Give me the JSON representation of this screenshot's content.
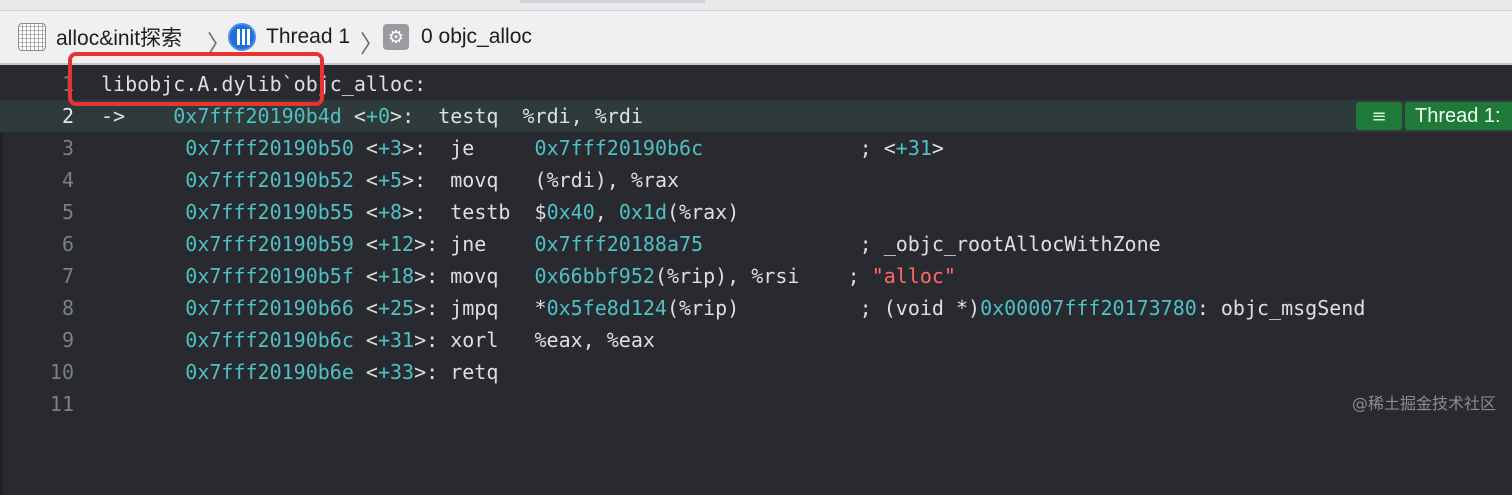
{
  "pathbar": {
    "project": "alloc&init探索",
    "thread": "Thread 1",
    "frame": "0 objc_alloc",
    "project_icon": "project-icon",
    "thread_icon": "thread-icon",
    "frame_icon": "gear-icon"
  },
  "editor": {
    "lines": [
      {
        "num": "1",
        "text": "libobjc.A.dylib`objc_alloc:"
      },
      {
        "num": "2",
        "arrow": "->",
        "addr": "0x7fff20190b4d",
        "off": "+0",
        "mnemonic": "testq",
        "ops": "%rdi, %rdi"
      },
      {
        "num": "3",
        "addr": "0x7fff20190b50",
        "off": "+3",
        "mnemonic": "je",
        "ops": "0x7fff20190b6c",
        "comment_off": "+31"
      },
      {
        "num": "4",
        "addr": "0x7fff20190b52",
        "off": "+5",
        "mnemonic": "movq",
        "ops": "(%rdi), %rax"
      },
      {
        "num": "5",
        "addr": "0x7fff20190b55",
        "off": "+8",
        "mnemonic": "testb",
        "ops_imm": "0x40",
        "ops_disp": "0x1d",
        "ops_reg": "(%rax)"
      },
      {
        "num": "6",
        "addr": "0x7fff20190b59",
        "off": "+12",
        "mnemonic": "jne",
        "ops": "0x7fff20188a75",
        "comment": "_objc_rootAllocWithZone"
      },
      {
        "num": "7",
        "addr": "0x7fff20190b5f",
        "off": "+18",
        "mnemonic": "movq",
        "ops_disp": "0x66bbf952",
        "ops_rest": "(%rip), %rsi",
        "comment_str": "\"alloc\""
      },
      {
        "num": "8",
        "addr": "0x7fff20190b66",
        "off": "+25",
        "mnemonic": "jmpq",
        "ops_disp": "0x5fe8d124",
        "ops_rest": "(%rip)",
        "comment_pre": "(void *)",
        "comment_addr": "0x00007fff20173780",
        "comment_post": ": objc_msgSend"
      },
      {
        "num": "9",
        "addr": "0x7fff20190b6c",
        "off": "+31",
        "mnemonic": "xorl",
        "ops": "%eax, %eax"
      },
      {
        "num": "10",
        "addr": "0x7fff20190b6e",
        "off": "+33",
        "mnemonic": "retq"
      },
      {
        "num": "11"
      }
    ]
  },
  "badge": {
    "menu_icon": "hamburger-icon",
    "thread_label": "Thread 1:"
  },
  "watermark": "@稀土掘金技术社区",
  "colors": {
    "background": "#292a30",
    "address": "#4ec1c4",
    "string": "#ff6b63",
    "highlight_box": "#e8342f",
    "badge": "#1f7a3a"
  }
}
